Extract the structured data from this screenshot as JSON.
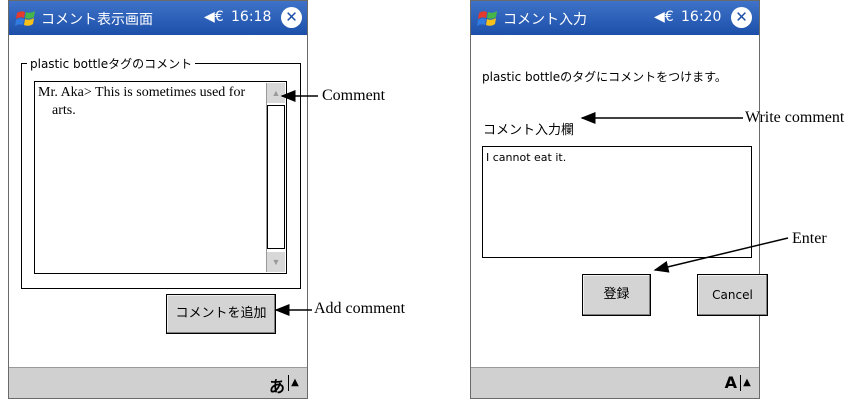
{
  "left_screen": {
    "titlebar": {
      "title": "コメント表示画面",
      "speaker": "◀€",
      "time": "16:18",
      "close": "✕"
    },
    "group_label": "plastic bottleタグのコメント",
    "comment_text": "Mr. Aka> This is sometimes used for arts.",
    "add_comment_button": "コメントを追加",
    "taskbar": {
      "ime": "あ",
      "arrow": "▲"
    },
    "icons": [
      "windows-flag-icon",
      "speaker-icon",
      "close-icon",
      "scroll-up-icon",
      "scroll-down-icon"
    ]
  },
  "right_screen": {
    "titlebar": {
      "title": "コメント入力",
      "speaker": "◀€",
      "time": "16:20",
      "close": "✕"
    },
    "info_text": "plastic bottleのタグにコメントをつけます。",
    "field_label": "コメント入力欄",
    "input_value": "I cannot eat it.",
    "register_button": "登録",
    "cancel_button": "Cancel",
    "taskbar": {
      "ime": "A",
      "arrow": "▲"
    }
  },
  "annotations": {
    "comment": "Comment",
    "add_comment": "Add comment",
    "write_comment": "Write comment",
    "enter": "Enter"
  },
  "colors": {
    "titlebar": "#1d4fa8",
    "taskbar": "#d0d0d0",
    "button": "#d4d4d4"
  }
}
